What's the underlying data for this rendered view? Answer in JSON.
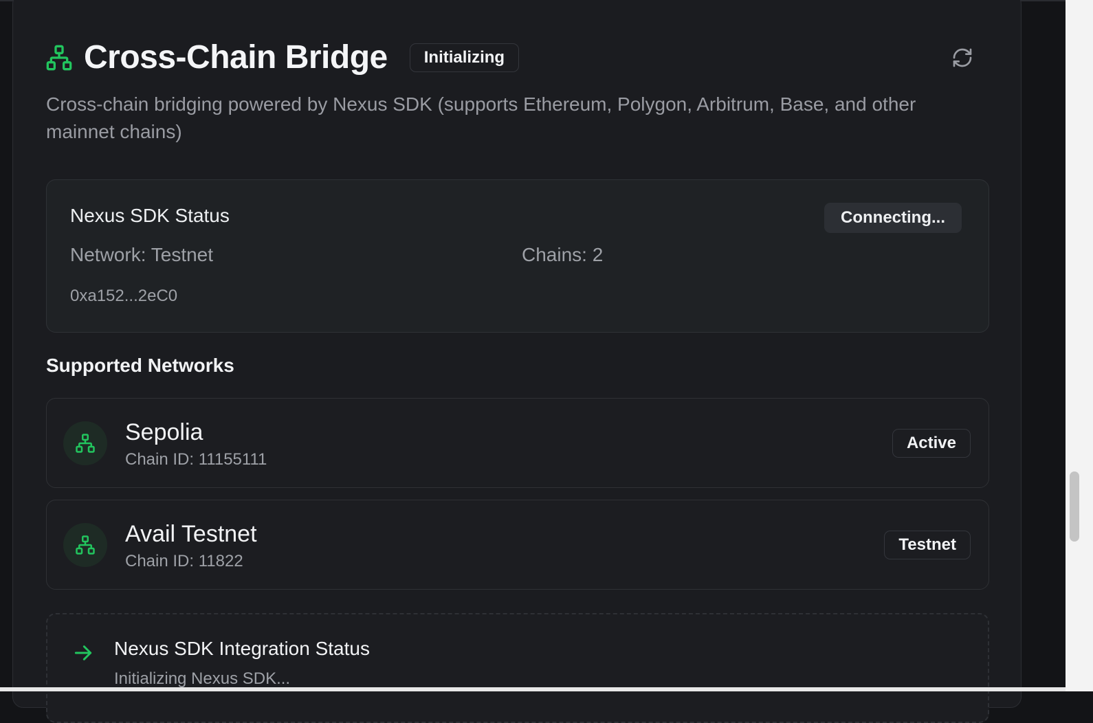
{
  "header": {
    "title": "Cross-Chain Bridge",
    "status_badge": "Initializing",
    "description": "Cross-chain bridging powered by Nexus SDK (supports Ethereum, Polygon, Arbitrum, Base, and other mainnet chains)"
  },
  "sdk_status": {
    "title": "Nexus SDK Status",
    "state": "Connecting...",
    "network": "Network: Testnet",
    "chains": "Chains: 2",
    "address": "0xa152...2eC0"
  },
  "networks": {
    "section_title": "Supported Networks",
    "items": [
      {
        "name": "Sepolia",
        "chain_id": "Chain ID: 11155111",
        "badge": "Active"
      },
      {
        "name": "Avail Testnet",
        "chain_id": "Chain ID: 11822",
        "badge": "Testnet"
      }
    ]
  },
  "integration": {
    "title": "Nexus SDK Integration Status",
    "subtitle": "Initializing Nexus SDK..."
  },
  "icons": {
    "title": "network-icon",
    "refresh": "refresh-icon",
    "network_item": "network-icon",
    "integration": "arrow-right-icon"
  },
  "colors": {
    "accent": "#22c55e",
    "background": "#1b1c20",
    "text_primary": "#f2f3f5",
    "text_muted": "#9ea1a7"
  }
}
